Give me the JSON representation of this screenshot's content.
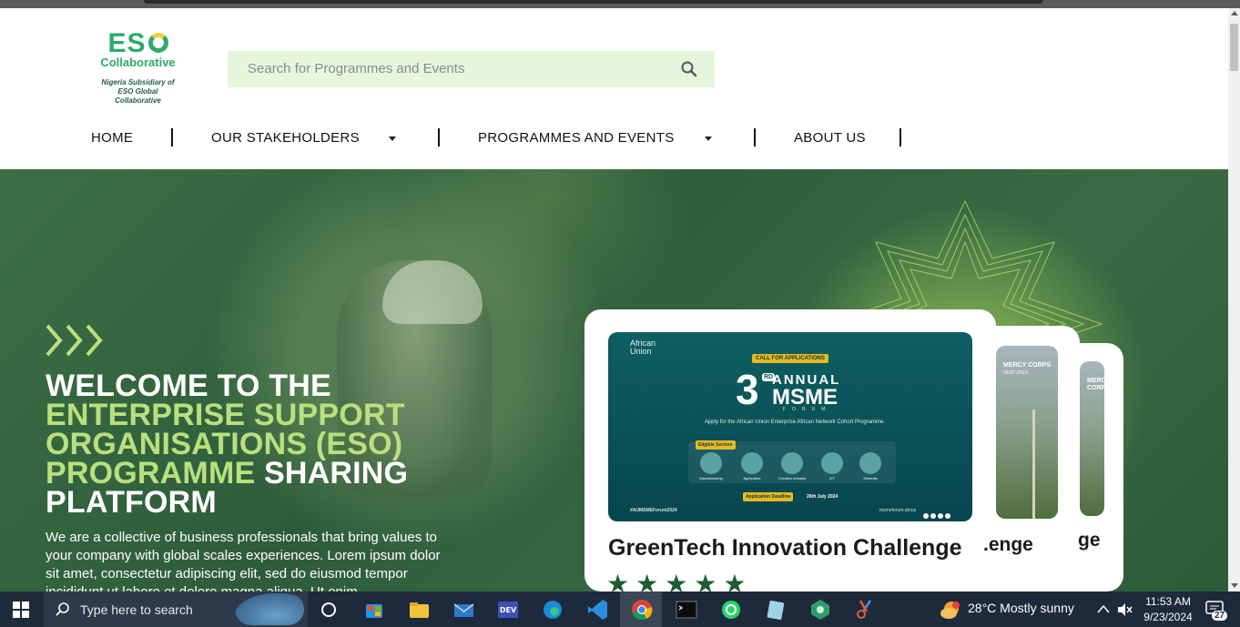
{
  "logo": {
    "name": "ESO",
    "sub": "Collaborative",
    "tagline": "Nigeria Subsidiary of ESO Global Collaborative"
  },
  "search": {
    "placeholder": "Search for Programmes and Events"
  },
  "nav": [
    {
      "label": "HOME"
    },
    {
      "label": "OUR STAKEHOLDERS"
    },
    {
      "label": "PROGRAMMES AND EVENTS"
    },
    {
      "label": "ABOUT US"
    }
  ],
  "hero": {
    "line1": "WELCOME TO THE",
    "line2": "ENTERPRISE SUPPORT ORGANISATIONS (ESO) PROGRAMME",
    "line3": "SHARING PLATFORM",
    "paragraph": "We are a collective of business professionals that bring values to your company with global scales experiences. Lorem ipsum dolor sit amet, consectetur adipiscing elit, sed do eiusmod tempor incididunt ut labore et dolore magna aliqua. Ut enim"
  },
  "cards": [
    {
      "title": "GreenTech Innovation Challenge",
      "rating": 5,
      "stars": "★★★★★"
    },
    {
      "title": ".enge"
    },
    {
      "title": "ge"
    }
  ],
  "poster": {
    "org": "African Union",
    "badge": "CALL FOR APPLICATIONS",
    "number": "3",
    "ordinal": "RD",
    "annual": "ANNUAL",
    "msme": "MSME",
    "forum": "FORUM",
    "apply": "Apply for the African Union Enterprise African Network Cohort Programme.",
    "eligible": "Eligible Sectors",
    "sectors": [
      "Manufacturing",
      "Agriculture",
      "Creative Industry",
      "ICT",
      "Minerals"
    ],
    "deadline_label": "Application Deadline",
    "deadline": "26th July 2024",
    "hashtag": "#AUMSMEForum2024",
    "site": "msmeforum.africa"
  },
  "side_poster": {
    "org": "MERCY CORPS",
    "sub": "VENTURES"
  },
  "taskbar": {
    "search": "Type here to search",
    "weather": "28°C  Mostly sunny",
    "time": "11:53 AM",
    "date": "9/23/2024",
    "notifications": "27"
  }
}
